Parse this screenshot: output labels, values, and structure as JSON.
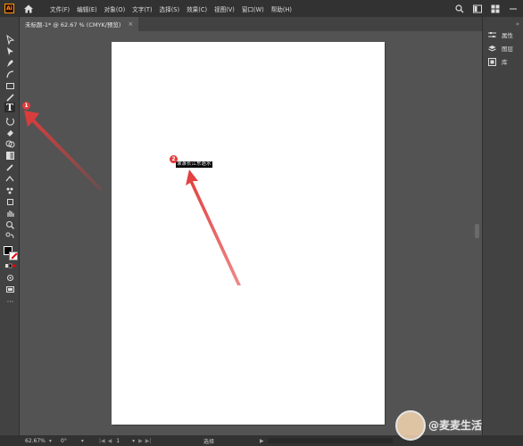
{
  "app": {
    "logo": "Ai",
    "accent": "#ff9a00"
  },
  "menu": {
    "items": [
      "文件(F)",
      "编辑(E)",
      "对象(O)",
      "文字(T)",
      "选择(S)",
      "效果(C)",
      "视图(V)",
      "窗口(W)",
      "帮助(H)"
    ]
  },
  "tab": {
    "title": "未标题-1* @ 62.67 % (CMYK/预览)",
    "close": "×"
  },
  "toolbar": {
    "text_tool": "T",
    "more": "···"
  },
  "canvas": {
    "selected_text": "滚滚长江东逝水"
  },
  "annotations": {
    "badge1": "1",
    "badge2": "2",
    "color": "#e23b3b"
  },
  "panels": {
    "items": [
      "属性",
      "图层",
      "库"
    ]
  },
  "status": {
    "zoom": "62.67%",
    "rotation": "0°",
    "artboard": "1",
    "mode": "选择"
  },
  "watermark": {
    "text": "@麦麦生活"
  }
}
